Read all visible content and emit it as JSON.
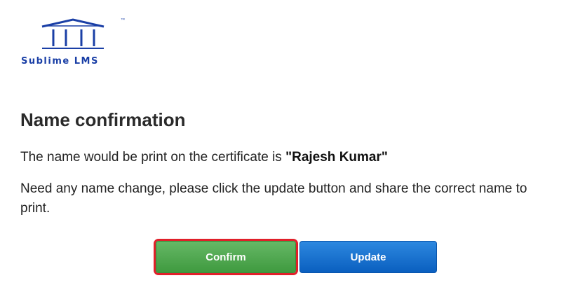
{
  "logo": {
    "name": "Sublime LMS",
    "tm": "™"
  },
  "page": {
    "title": "Name confirmation",
    "line1_prefix": "The name would be print on the certificate is ",
    "line1_name": "\"Rajesh Kumar\"",
    "line2": "Need any name change, please click the update button and share the correct name to print."
  },
  "buttons": {
    "confirm_label": "Confirm",
    "update_label": "Update"
  },
  "colors": {
    "brand": "#1a3fa6",
    "confirm": "#4caf50",
    "update": "#0a6ad0",
    "highlight": "#e0202a"
  }
}
